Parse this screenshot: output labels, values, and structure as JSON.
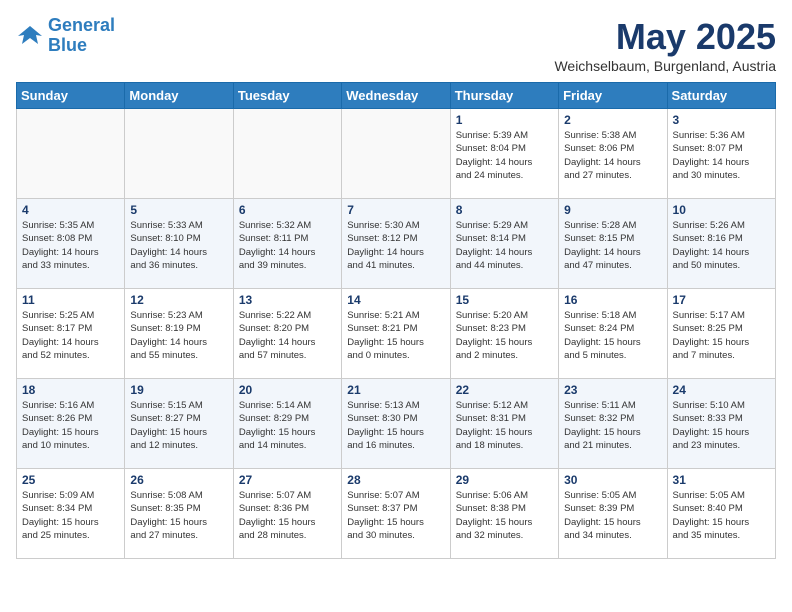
{
  "logo": {
    "line1": "General",
    "line2": "Blue"
  },
  "title": "May 2025",
  "subtitle": "Weichselbaum, Burgenland, Austria",
  "weekdays": [
    "Sunday",
    "Monday",
    "Tuesday",
    "Wednesday",
    "Thursday",
    "Friday",
    "Saturday"
  ],
  "weeks": [
    [
      {
        "day": "",
        "info": ""
      },
      {
        "day": "",
        "info": ""
      },
      {
        "day": "",
        "info": ""
      },
      {
        "day": "",
        "info": ""
      },
      {
        "day": "1",
        "info": "Sunrise: 5:39 AM\nSunset: 8:04 PM\nDaylight: 14 hours\nand 24 minutes."
      },
      {
        "day": "2",
        "info": "Sunrise: 5:38 AM\nSunset: 8:06 PM\nDaylight: 14 hours\nand 27 minutes."
      },
      {
        "day": "3",
        "info": "Sunrise: 5:36 AM\nSunset: 8:07 PM\nDaylight: 14 hours\nand 30 minutes."
      }
    ],
    [
      {
        "day": "4",
        "info": "Sunrise: 5:35 AM\nSunset: 8:08 PM\nDaylight: 14 hours\nand 33 minutes."
      },
      {
        "day": "5",
        "info": "Sunrise: 5:33 AM\nSunset: 8:10 PM\nDaylight: 14 hours\nand 36 minutes."
      },
      {
        "day": "6",
        "info": "Sunrise: 5:32 AM\nSunset: 8:11 PM\nDaylight: 14 hours\nand 39 minutes."
      },
      {
        "day": "7",
        "info": "Sunrise: 5:30 AM\nSunset: 8:12 PM\nDaylight: 14 hours\nand 41 minutes."
      },
      {
        "day": "8",
        "info": "Sunrise: 5:29 AM\nSunset: 8:14 PM\nDaylight: 14 hours\nand 44 minutes."
      },
      {
        "day": "9",
        "info": "Sunrise: 5:28 AM\nSunset: 8:15 PM\nDaylight: 14 hours\nand 47 minutes."
      },
      {
        "day": "10",
        "info": "Sunrise: 5:26 AM\nSunset: 8:16 PM\nDaylight: 14 hours\nand 50 minutes."
      }
    ],
    [
      {
        "day": "11",
        "info": "Sunrise: 5:25 AM\nSunset: 8:17 PM\nDaylight: 14 hours\nand 52 minutes."
      },
      {
        "day": "12",
        "info": "Sunrise: 5:23 AM\nSunset: 8:19 PM\nDaylight: 14 hours\nand 55 minutes."
      },
      {
        "day": "13",
        "info": "Sunrise: 5:22 AM\nSunset: 8:20 PM\nDaylight: 14 hours\nand 57 minutes."
      },
      {
        "day": "14",
        "info": "Sunrise: 5:21 AM\nSunset: 8:21 PM\nDaylight: 15 hours\nand 0 minutes."
      },
      {
        "day": "15",
        "info": "Sunrise: 5:20 AM\nSunset: 8:23 PM\nDaylight: 15 hours\nand 2 minutes."
      },
      {
        "day": "16",
        "info": "Sunrise: 5:18 AM\nSunset: 8:24 PM\nDaylight: 15 hours\nand 5 minutes."
      },
      {
        "day": "17",
        "info": "Sunrise: 5:17 AM\nSunset: 8:25 PM\nDaylight: 15 hours\nand 7 minutes."
      }
    ],
    [
      {
        "day": "18",
        "info": "Sunrise: 5:16 AM\nSunset: 8:26 PM\nDaylight: 15 hours\nand 10 minutes."
      },
      {
        "day": "19",
        "info": "Sunrise: 5:15 AM\nSunset: 8:27 PM\nDaylight: 15 hours\nand 12 minutes."
      },
      {
        "day": "20",
        "info": "Sunrise: 5:14 AM\nSunset: 8:29 PM\nDaylight: 15 hours\nand 14 minutes."
      },
      {
        "day": "21",
        "info": "Sunrise: 5:13 AM\nSunset: 8:30 PM\nDaylight: 15 hours\nand 16 minutes."
      },
      {
        "day": "22",
        "info": "Sunrise: 5:12 AM\nSunset: 8:31 PM\nDaylight: 15 hours\nand 18 minutes."
      },
      {
        "day": "23",
        "info": "Sunrise: 5:11 AM\nSunset: 8:32 PM\nDaylight: 15 hours\nand 21 minutes."
      },
      {
        "day": "24",
        "info": "Sunrise: 5:10 AM\nSunset: 8:33 PM\nDaylight: 15 hours\nand 23 minutes."
      }
    ],
    [
      {
        "day": "25",
        "info": "Sunrise: 5:09 AM\nSunset: 8:34 PM\nDaylight: 15 hours\nand 25 minutes."
      },
      {
        "day": "26",
        "info": "Sunrise: 5:08 AM\nSunset: 8:35 PM\nDaylight: 15 hours\nand 27 minutes."
      },
      {
        "day": "27",
        "info": "Sunrise: 5:07 AM\nSunset: 8:36 PM\nDaylight: 15 hours\nand 28 minutes."
      },
      {
        "day": "28",
        "info": "Sunrise: 5:07 AM\nSunset: 8:37 PM\nDaylight: 15 hours\nand 30 minutes."
      },
      {
        "day": "29",
        "info": "Sunrise: 5:06 AM\nSunset: 8:38 PM\nDaylight: 15 hours\nand 32 minutes."
      },
      {
        "day": "30",
        "info": "Sunrise: 5:05 AM\nSunset: 8:39 PM\nDaylight: 15 hours\nand 34 minutes."
      },
      {
        "day": "31",
        "info": "Sunrise: 5:05 AM\nSunset: 8:40 PM\nDaylight: 15 hours\nand 35 minutes."
      }
    ]
  ]
}
